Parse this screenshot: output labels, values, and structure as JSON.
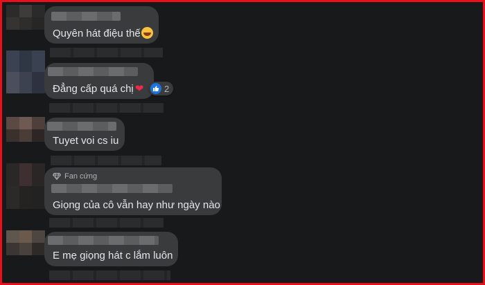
{
  "comments": [
    {
      "text": "Quyên hát điệu thế",
      "emoji": "grinning-squinting-face-icon"
    },
    {
      "text": "Đẳng cấp quá chị",
      "emoji": "red-heart-icon",
      "reaction_count": "2"
    },
    {
      "text": "Tuyet voi cs iu"
    },
    {
      "text": "Giọng của cô vẫn hay như ngày nào",
      "badge": "Fan cứng"
    },
    {
      "text": "E mẹ giọng hát c lắm luôn"
    }
  ],
  "colors": {
    "frame_border": "#e8101a",
    "background": "#18191a",
    "bubble": "#3a3b3c",
    "text": "#e4e6eb",
    "secondary_text": "#b0b3b8",
    "like_blue": "#1b74e4"
  }
}
